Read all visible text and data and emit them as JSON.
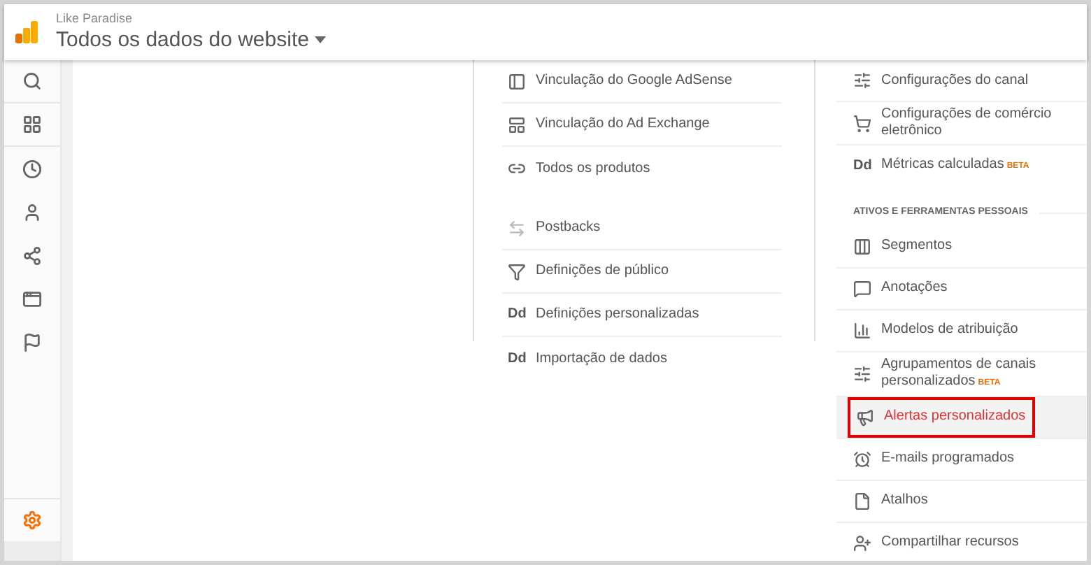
{
  "header": {
    "account": "Like Paradise",
    "view": "Todos os dados do website"
  },
  "sidebar": {
    "items": [
      {
        "selected": false
      },
      {
        "selected": false
      },
      {
        "selected": false
      },
      {
        "selected": false
      },
      {
        "selected": false
      },
      {
        "selected": false
      },
      {
        "selected": false
      }
    ],
    "settings": {
      "selected": true
    }
  },
  "middle_column": {
    "groups": [
      {
        "items": [
          {
            "label": "Vinculação do Google AdSense"
          },
          {
            "label": "Vinculação do Ad Exchange"
          },
          {
            "label": "Todos os produtos"
          }
        ]
      },
      {
        "items": [
          {
            "label": "Postbacks"
          },
          {
            "label": "Definições de público"
          },
          {
            "label": "Definições personalizadas",
            "icon_text": "Dd"
          },
          {
            "label": "Importação de dados",
            "icon_text": "Dd"
          }
        ]
      }
    ]
  },
  "right_column": {
    "groups": [
      {
        "items": [
          {
            "label": "Configurações do canal",
            "selected": false
          },
          {
            "label": "Configurações de comércio eletrônico",
            "selected": false
          },
          {
            "label": "Métricas calculadas",
            "icon_text": "Dd",
            "badge": "BETA",
            "selected": false
          }
        ]
      },
      {
        "heading": "ATIVOS E FERRAMENTAS PESSOAIS",
        "items": [
          {
            "label": "Segmentos",
            "selected": false
          },
          {
            "label": "Anotações",
            "selected": false
          },
          {
            "label": "Modelos de atribuição",
            "selected": false
          },
          {
            "label": "Agrupamentos de canais personalizados",
            "badge": "BETA",
            "selected": false
          },
          {
            "label": "Alertas personalizados",
            "selected": true
          },
          {
            "label": "E-mails programados",
            "selected": false
          },
          {
            "label": "Atalhos",
            "selected": false
          },
          {
            "label": "Compartilhar recursos",
            "selected": false
          }
        ]
      }
    ]
  }
}
